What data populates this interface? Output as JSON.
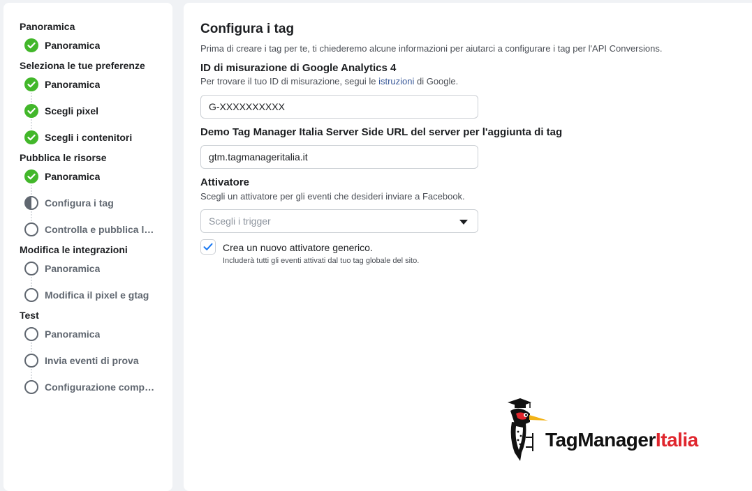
{
  "sidebar": {
    "sections": [
      {
        "title": "Panoramica"
      },
      {
        "title": "Seleziona le tue preferenze"
      },
      {
        "title": "Pubblica le risorse"
      },
      {
        "title": "Modifica le integrazioni"
      },
      {
        "title": "Test"
      }
    ],
    "steps": [
      {
        "label": "Panoramica",
        "status": "done"
      },
      {
        "label": "Panoramica",
        "status": "done"
      },
      {
        "label": "Scegli pixel",
        "status": "done"
      },
      {
        "label": "Scegli i contenitori",
        "status": "done"
      },
      {
        "label": "Panoramica",
        "status": "done"
      },
      {
        "label": "Configura i tag",
        "status": "current"
      },
      {
        "label": "Controlla e pubblica le …",
        "status": "todo"
      },
      {
        "label": "Panoramica",
        "status": "todo"
      },
      {
        "label": "Modifica il pixel e gtag",
        "status": "todo"
      },
      {
        "label": "Panoramica",
        "status": "todo"
      },
      {
        "label": "Invia eventi di prova",
        "status": "todo"
      },
      {
        "label": "Configurazione comple…",
        "status": "todo"
      }
    ]
  },
  "main": {
    "title": "Configura i tag",
    "intro": "Prima di creare i tag per te, ti chiederemo alcune informazioni per aiutarci a configurare i tag per l'API Conversions.",
    "ga4": {
      "title": "ID di misurazione di Google Analytics 4",
      "help_prefix": "Per trovare il tuo ID di misurazione, segui le ",
      "help_link": "istruzioni",
      "help_suffix": " di Google.",
      "value": "G-XXXXXXXXXX"
    },
    "server": {
      "title": "Demo Tag Manager Italia Server Side URL del server per l'aggiunta di tag",
      "value": "gtm.tagmanageritalia.it"
    },
    "trigger": {
      "title": "Attivatore",
      "help": "Scegli un attivatore per gli eventi che desideri inviare a Facebook.",
      "placeholder": "Scegli i trigger",
      "checkbox_checked": true,
      "checkbox_label": "Crea un nuovo attivatore generico.",
      "checkbox_help": "Includerà tutti gli eventi attivati dal tuo tag globale del sito."
    }
  },
  "logo": {
    "text_a": "TagManager",
    "text_b": "Italia"
  },
  "colors": {
    "done_green": "#42b72a",
    "accent_blue": "#1877f2",
    "logo_red": "#e0262d"
  }
}
